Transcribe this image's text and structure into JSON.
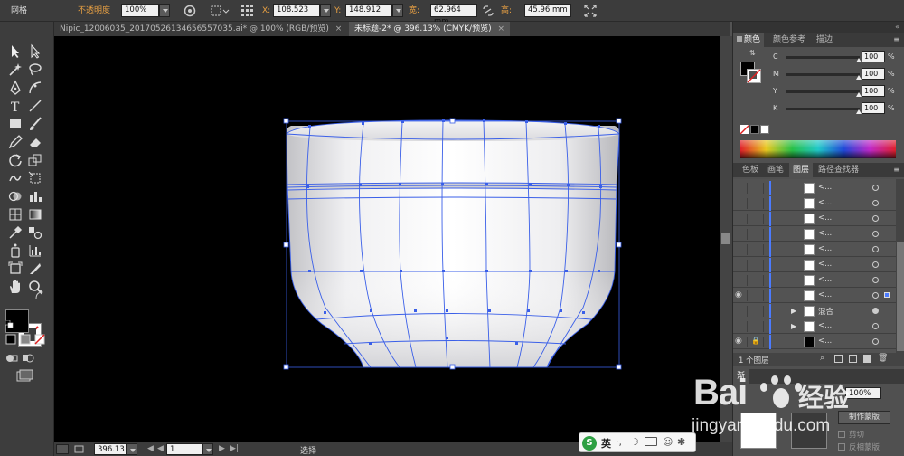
{
  "control_bar": {
    "mode_label": "网格",
    "opacity_label": "不透明度",
    "opacity_value": "100%",
    "x_label": "X:",
    "x_value": "108.523",
    "y_label": "Y:",
    "y_value": "148.912",
    "width_label": "宽:",
    "width_value": "62.964 mm",
    "height_label": "高:",
    "height_value": "45.96 mm"
  },
  "tabs": [
    {
      "label": "Nipic_12006035_20170526134656557035.ai* @ 100% (RGB/预览)"
    },
    {
      "label": "未标题-2* @ 396.13% (CMYK/预览)"
    }
  ],
  "tab_close": "×",
  "color_panel": {
    "tabs": [
      "颜色",
      "颜色参考",
      "描边"
    ],
    "channels": [
      {
        "label": "C",
        "value": "100",
        "unit": "%",
        "level": 1.0
      },
      {
        "label": "M",
        "value": "100",
        "unit": "%",
        "level": 1.0
      },
      {
        "label": "Y",
        "value": "100",
        "unit": "%",
        "level": 1.0
      },
      {
        "label": "K",
        "value": "100",
        "unit": "%",
        "level": 1.0
      }
    ]
  },
  "layers_panel": {
    "tabs": [
      "色板",
      "画笔",
      "图层",
      "路径查找器"
    ],
    "rows": [
      {
        "name": "<..."
      },
      {
        "name": "<..."
      },
      {
        "name": "<..."
      },
      {
        "name": "<..."
      },
      {
        "name": "<..."
      },
      {
        "name": "<..."
      },
      {
        "name": "<..."
      },
      {
        "name": "<..."
      },
      {
        "name": "混合"
      },
      {
        "name": "<..."
      },
      {
        "name": "<..."
      }
    ],
    "count_label": "1 个图层"
  },
  "transparency_panel": {
    "tab": "渐",
    "opacity_value": "100%",
    "make_mask_label": "制作蒙版",
    "clip_label": "剪切",
    "invert_label": "反相蒙版"
  },
  "status_bar": {
    "zoom_value": "396.13",
    "page_value": "1",
    "tool_name": "选择"
  },
  "watermark": {
    "brand": "Bai",
    "brand_suffix": "经验",
    "url": "jingyan.baidu.com"
  },
  "ime": {
    "label": "英"
  },
  "colors": {
    "mesh_line": "#3a5fe8",
    "canvas_bg": "#000000",
    "ui_dark": "#3c3c3c",
    "ui_panel": "#505050",
    "accent_orange": "#e8a043"
  }
}
